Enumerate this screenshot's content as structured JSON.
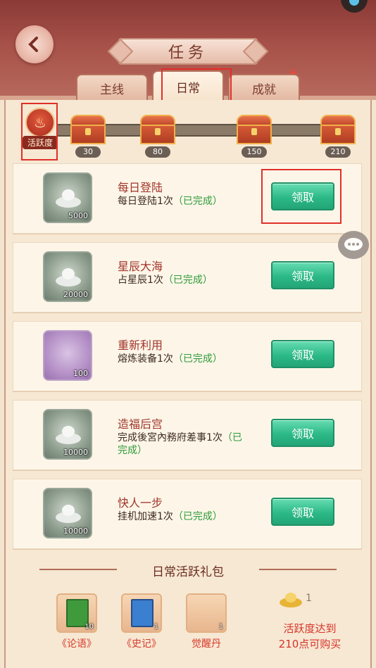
{
  "header": {
    "title": "任务"
  },
  "tabs": [
    {
      "label": "主线",
      "active": false
    },
    {
      "label": "日常",
      "active": true
    },
    {
      "label": "成就",
      "active": false
    }
  ],
  "activity": {
    "label": "活跃度",
    "milestones": [
      "30",
      "80",
      "150",
      "210"
    ]
  },
  "tasks": [
    {
      "title": "每日登陆",
      "desc": "每日登陆1次",
      "status": "（已完成）",
      "reward_qty": "5000",
      "reward": "silver-ingot-icon",
      "button": "领取"
    },
    {
      "title": "星辰大海",
      "desc": "占星辰1次",
      "status": "（已完成）",
      "reward_qty": "20000",
      "reward": "silver-ingot-icon",
      "button": "领取"
    },
    {
      "title": "重新利用",
      "desc": "熔炼装备1次",
      "status": "（已完成）",
      "reward_qty": "100",
      "reward": "purple-item-icon",
      "button": "领取"
    },
    {
      "title": "造福后宫",
      "desc": "完成後宮內務府差事1次",
      "status": "（已完成）",
      "reward_qty": "10000",
      "reward": "silver-ingot-icon",
      "button": "领取"
    },
    {
      "title": "快人一步",
      "desc": "挂机加速1次",
      "status": "（已完成）",
      "reward_qty": "10000",
      "reward": "silver-ingot-icon",
      "button": "领取"
    }
  ],
  "gift_pack": {
    "title": "日常活跃礼包",
    "items": [
      {
        "label": "《论语》",
        "qty": "10"
      },
      {
        "label": "《史记》",
        "qty": "1"
      },
      {
        "label": "觉醒丹",
        "qty": "1"
      }
    ],
    "price": "1",
    "note_line1": "活跃度达到",
    "note_line2": "210点可购买"
  },
  "colors": {
    "header": "#a65149",
    "claim_button": "#2cb987",
    "title_red": "#a1352b",
    "done_green": "#2f9a3a",
    "highlight": "#e0302a"
  }
}
